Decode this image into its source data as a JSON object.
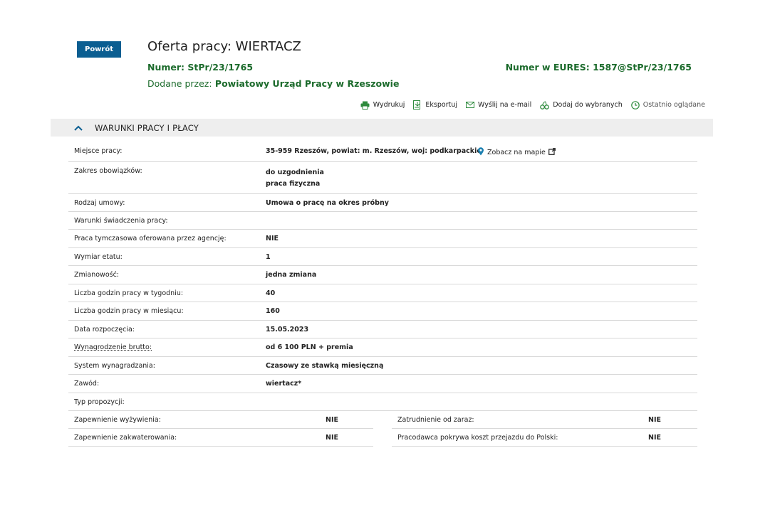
{
  "header": {
    "back_label": "Powrót",
    "title": "Oferta pracy: WIERTACZ",
    "numer_label": "Numer:",
    "numer_value": "StPr/23/1765",
    "eures_label": "Numer w EURES:",
    "eures_value": "1587@StPr/23/1765",
    "dodane_label": "Dodane przez:",
    "dodane_value": "Powiatowy Urząd Pracy w Rzeszowie"
  },
  "toolbar": {
    "print": "Wydrukuj",
    "export": "Eksportuj",
    "email": "Wyślij na e-mail",
    "favorite": "Dodaj do wybranych",
    "recent": "Ostatnio oglądane"
  },
  "section": {
    "title": "WARUNKI PRACY I PŁACY"
  },
  "map_link": "Zobacz na mapie",
  "rows": [
    {
      "key": "Miejsce pracy:",
      "value": [
        "35-959 Rzeszów, powiat: m. Rzeszów, woj: podkarpackie"
      ]
    },
    {
      "key": "Zakres obowiązków:",
      "value": [
        "do uzgodnienia",
        "praca fizyczna"
      ]
    },
    {
      "key": "Rodzaj umowy:",
      "value": [
        "Umowa o pracę na okres próbny"
      ]
    },
    {
      "key": "Warunki świadczenia pracy:",
      "value": []
    },
    {
      "key": "Praca tymczasowa oferowana przez agencję:",
      "value": [
        "NIE"
      ]
    },
    {
      "key": "Wymiar etatu:",
      "value": [
        "1"
      ]
    },
    {
      "key": "Zmianowość:",
      "value": [
        "jedna zmiana"
      ]
    },
    {
      "key": "Liczba godzin pracy w tygodniu:",
      "value": [
        "40"
      ]
    },
    {
      "key": "Liczba godzin pracy w miesiącu:",
      "value": [
        "160"
      ]
    },
    {
      "key": "Data rozpoczęcia:",
      "value": [
        "15.05.2023"
      ]
    },
    {
      "key": "Wynagrodzenie brutto:",
      "value": [
        "od 6 100 PLN + premia"
      ]
    },
    {
      "key": "System wynagradzania:",
      "value": [
        "Czasowy ze stawką miesięczną"
      ]
    },
    {
      "key": "Zawód:",
      "value": [
        "wiertacz*"
      ]
    },
    {
      "key": "Typ propozycji:",
      "value": []
    }
  ],
  "split": {
    "left": [
      {
        "key": "Zapewnienie wyżywienia:",
        "value": "NIE"
      },
      {
        "key": "Zapewnienie zakwaterowania:",
        "value": "NIE"
      }
    ],
    "right": [
      {
        "key": "Zatrudnienie od zaraz:",
        "value": "NIE"
      },
      {
        "key": "Pracodawca pokrywa koszt przejazdu do Polski:",
        "value": "NIE"
      }
    ]
  },
  "colors": {
    "primary_button": "#0b5e91",
    "green_text": "#1c6b2c",
    "section_bg": "#eeeeee"
  }
}
